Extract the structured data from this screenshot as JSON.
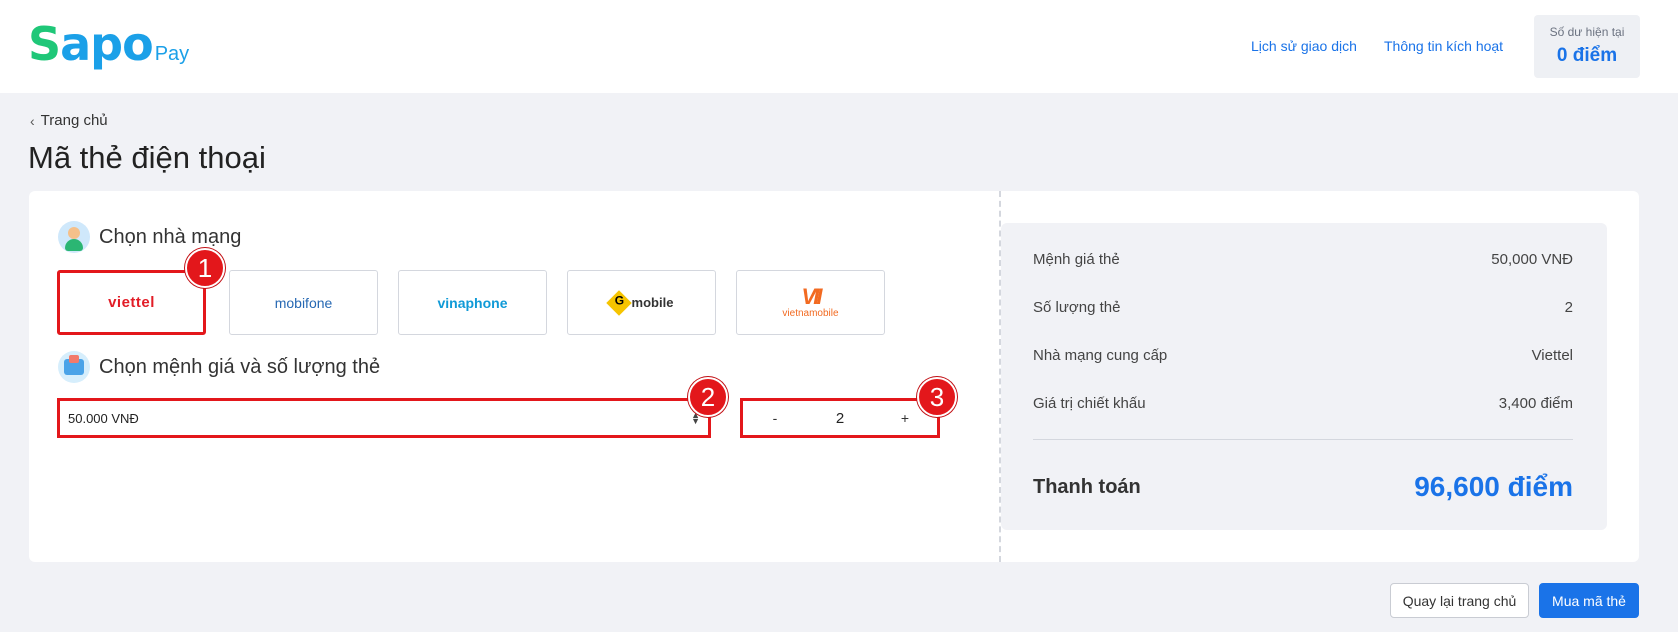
{
  "header": {
    "logo_s": "S",
    "logo_apo": "apo",
    "logo_pay": "Pay",
    "nav": {
      "history": "Lịch sử giao dịch",
      "activation": "Thông tin kích hoạt"
    },
    "balance": {
      "label": "Số dư hiện tại",
      "value": "0 điểm"
    }
  },
  "breadcrumb": {
    "label": "Trang chủ"
  },
  "page_title": "Mã thẻ điện thoại",
  "carrier_section": {
    "title": "Chọn nhà mạng",
    "carriers": [
      {
        "label": "viettel",
        "selected": true
      },
      {
        "label": "mobifone",
        "selected": false
      },
      {
        "label": "vinaphone",
        "selected": false
      },
      {
        "label": "mobile",
        "selected": false
      },
      {
        "label": "vietnamobile",
        "selected": false
      }
    ]
  },
  "amount_section": {
    "title": "Chọn mệnh giá và số lượng thẻ",
    "select_value": "50.000 VNĐ",
    "stepper": {
      "minus": "-",
      "value": "2",
      "plus": "+"
    }
  },
  "markers": [
    "1",
    "2",
    "3"
  ],
  "summary": {
    "rows": [
      {
        "label": "Mệnh giá thẻ",
        "value": "50,000 VNĐ"
      },
      {
        "label": "Số lượng thẻ",
        "value": "2"
      },
      {
        "label": "Nhà mạng cung cấp",
        "value": "Viettel"
      },
      {
        "label": "Giá trị chiết khấu",
        "value": "3,400 điểm"
      }
    ],
    "total_label": "Thanh toán",
    "total_value": "96,600 điểm"
  },
  "footer": {
    "back_label": "Quay lại trang chủ",
    "buy_label": "Mua mã thẻ"
  },
  "colors": {
    "accent": "#1a73e8",
    "highlight": "#e3171b",
    "background": "#f1f2f6"
  }
}
